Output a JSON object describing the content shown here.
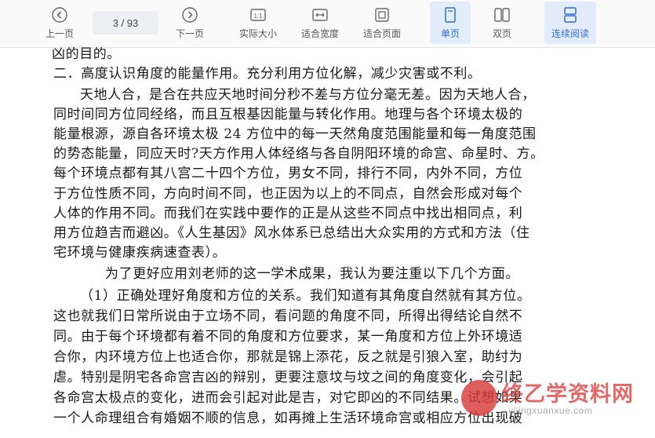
{
  "toolbar": {
    "prev": "上一页",
    "page_indicator": "3  /  93",
    "next": "下一页",
    "actual_size": "实际大小",
    "fit_width": "适合宽度",
    "fit_page": "适合页面",
    "single_page": "单页",
    "double_page": "双页",
    "continuous": "连续阅读"
  },
  "accent_color": "#2f6fd6",
  "document": {
    "lines": [
      "凶的目的。",
      "二．高度认识角度的能量作用。充分利用方位化解，减少灾害或不利。",
      "天地人合，是合在共应天地时间分秒不差与方位分毫无差。因为天地人合，",
      "同时间同方位同经络，而且互根基因能量与转化作用。地理与各个环境太极的",
      "能量根源，源自各环境太极 24 方位中的每一天然角度范围能量和每一角度范围",
      "的势态能量，同应天时?天方作用人体经络与各自阴阳环境的命宫、命星时、方。",
      "每个环境点都有其八宫二十四个方位，男女不同，排行不同，内外不同，方位",
      "于方位性质不同，方向时间不同，也正因为以上的不同点，自然会形成对每个",
      "人体的作用不同。而我们在实践中要作的正是从这些不同点中找出相同点，利",
      "用方位趋吉而避凶。《人生基因》风水体系已总结出大众实用的方式和方法（住",
      "宅环境与健康疾病速查表）。",
      "为了更好应用刘老师的这一学术成果，我认为要注重以下几个方面。",
      "（1）正确处理好角度和方位的关系。我们知道有其角度自然就有其方位。",
      "这也就我们日常所说由于立场不同，看问题的角度不同，所得出得结论自然不",
      "同。由于每个环境都有着不同的角度和方位要求，某一角度和方位上外环境适",
      "合你，内环境方位上也适合你，那就是锦上添花，反之就是引狼入室，助纣为",
      "虐。特别是阴宅各命宫吉凶的辩别，更要注意坟与坟之间的角度变化，会引起",
      "各命宫太极点的变化，进而会引起对此是吉，对它即凶的不同结果。试想如果",
      "一个人命理组合有婚姻不顺的信息，如再摊上生活环境命宫或相应方位出现破"
    ]
  },
  "watermark": {
    "title": "终乙学资料网",
    "url": "yijingxuanxue.com"
  }
}
